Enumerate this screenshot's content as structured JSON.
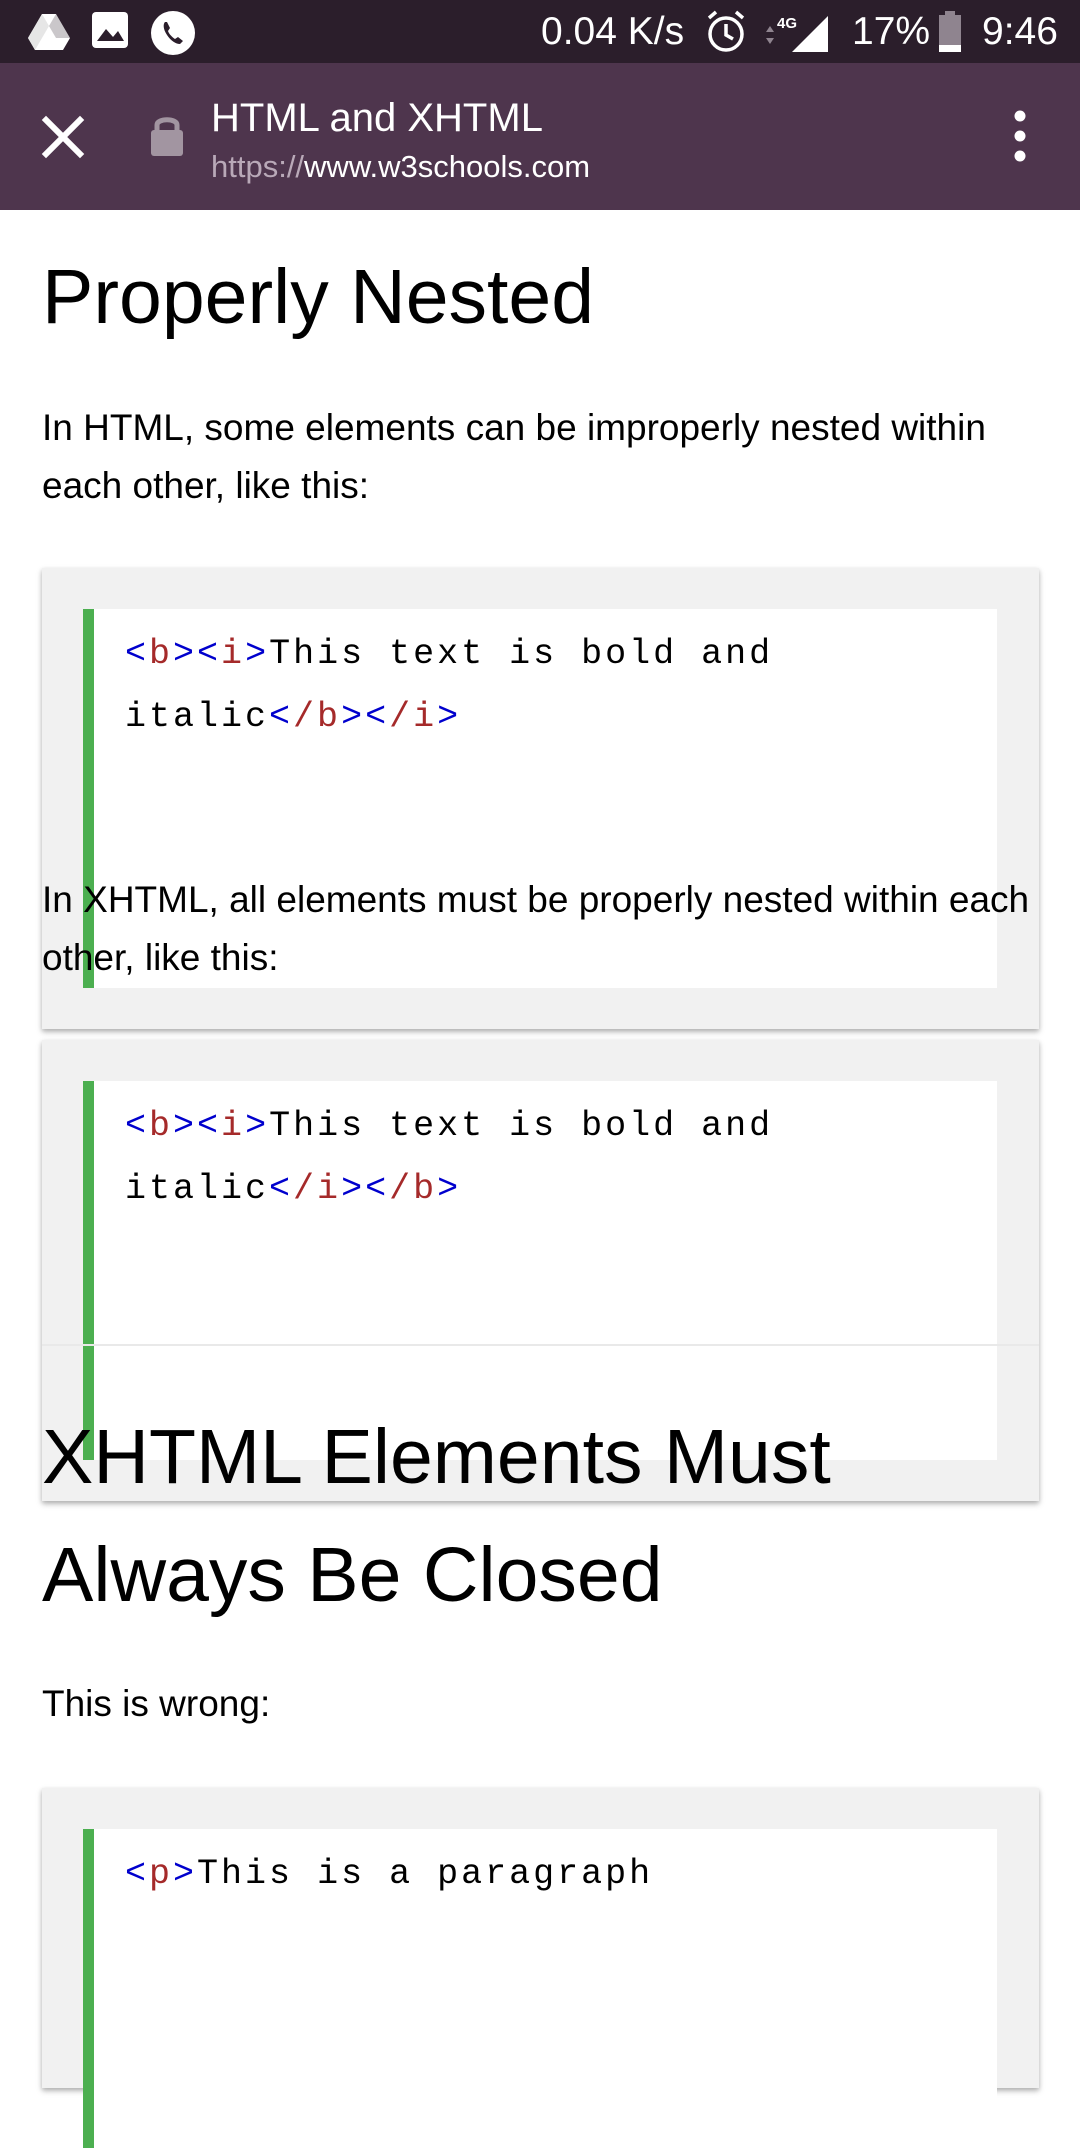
{
  "status_bar": {
    "net_speed": "0.04 K/s",
    "network_type": "4G",
    "battery": "17%",
    "time": "9:46",
    "left_icons": [
      "drive-icon",
      "gallery-icon",
      "phone-icon"
    ]
  },
  "browser": {
    "title": "HTML and XHTML",
    "url_scheme": "https://",
    "url_host": "www.w3schools.com"
  },
  "sections": {
    "nested": {
      "heading": "Properly Nested",
      "intro": "In HTML, some elements can be improperly nested within each other, like this:",
      "example_wrong": {
        "line1": {
          "open_b": "b",
          "open_i": "i",
          "text": "This text is bold and"
        },
        "line2": {
          "text": "italic",
          "close1": "/b",
          "close2": "/i"
        }
      },
      "intro2": "In XHTML, all elements must be properly nested within each other, like this:",
      "example_right": {
        "line1": {
          "open_b": "b",
          "open_i": "i",
          "text": "This text is bold and"
        },
        "line2": {
          "text": "italic",
          "close1": "/i",
          "close2": "/b"
        }
      }
    },
    "closed": {
      "heading_line1": "XHTML Elements Must",
      "heading_line2": "Always Be Closed",
      "intro": "This is wrong:",
      "example": {
        "tag": "p",
        "text": "This is a paragraph"
      }
    }
  },
  "colors": {
    "status_bar_bg": "#2b1e2b",
    "toolbar_bg": "#4e354d",
    "code_accent": "#4caf50",
    "tag_bracket": "#0000cd",
    "tag_name": "#a52a2a"
  }
}
